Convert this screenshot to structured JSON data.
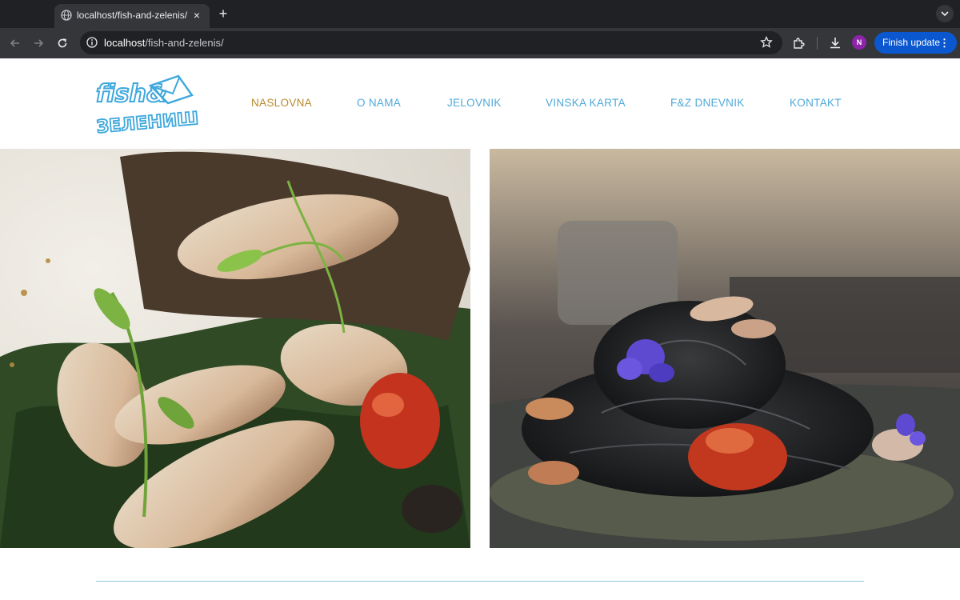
{
  "browser": {
    "tab": {
      "title": "localhost/fish-and-zelenis/",
      "close_label": "×"
    },
    "new_tab_label": "+",
    "address": {
      "host": "localhost",
      "path": "/fish-and-zelenis/"
    },
    "profile_initial": "N",
    "update_button": {
      "label": "Finish update",
      "menu": "⋮"
    }
  },
  "site": {
    "logo": {
      "line1": "fish&",
      "line2": "ЗЕЛЕНИШ"
    },
    "nav": [
      {
        "label": "NASLOVNA",
        "active": true
      },
      {
        "label": "O NAMA",
        "active": false
      },
      {
        "label": "JELOVNIK",
        "active": false
      },
      {
        "label": "VINSKA KARTA",
        "active": false
      },
      {
        "label": "F&Z DNEVNIK",
        "active": false
      },
      {
        "label": "KONTAKT",
        "active": false
      }
    ],
    "colors": {
      "nav": "#4ea9d8",
      "nav_active": "#b98a2a",
      "divider": "#8fcbe6"
    },
    "hero_images": [
      {
        "alt": "grilled-squid-dish"
      },
      {
        "alt": "black-squid-ink-pasta"
      }
    ]
  }
}
